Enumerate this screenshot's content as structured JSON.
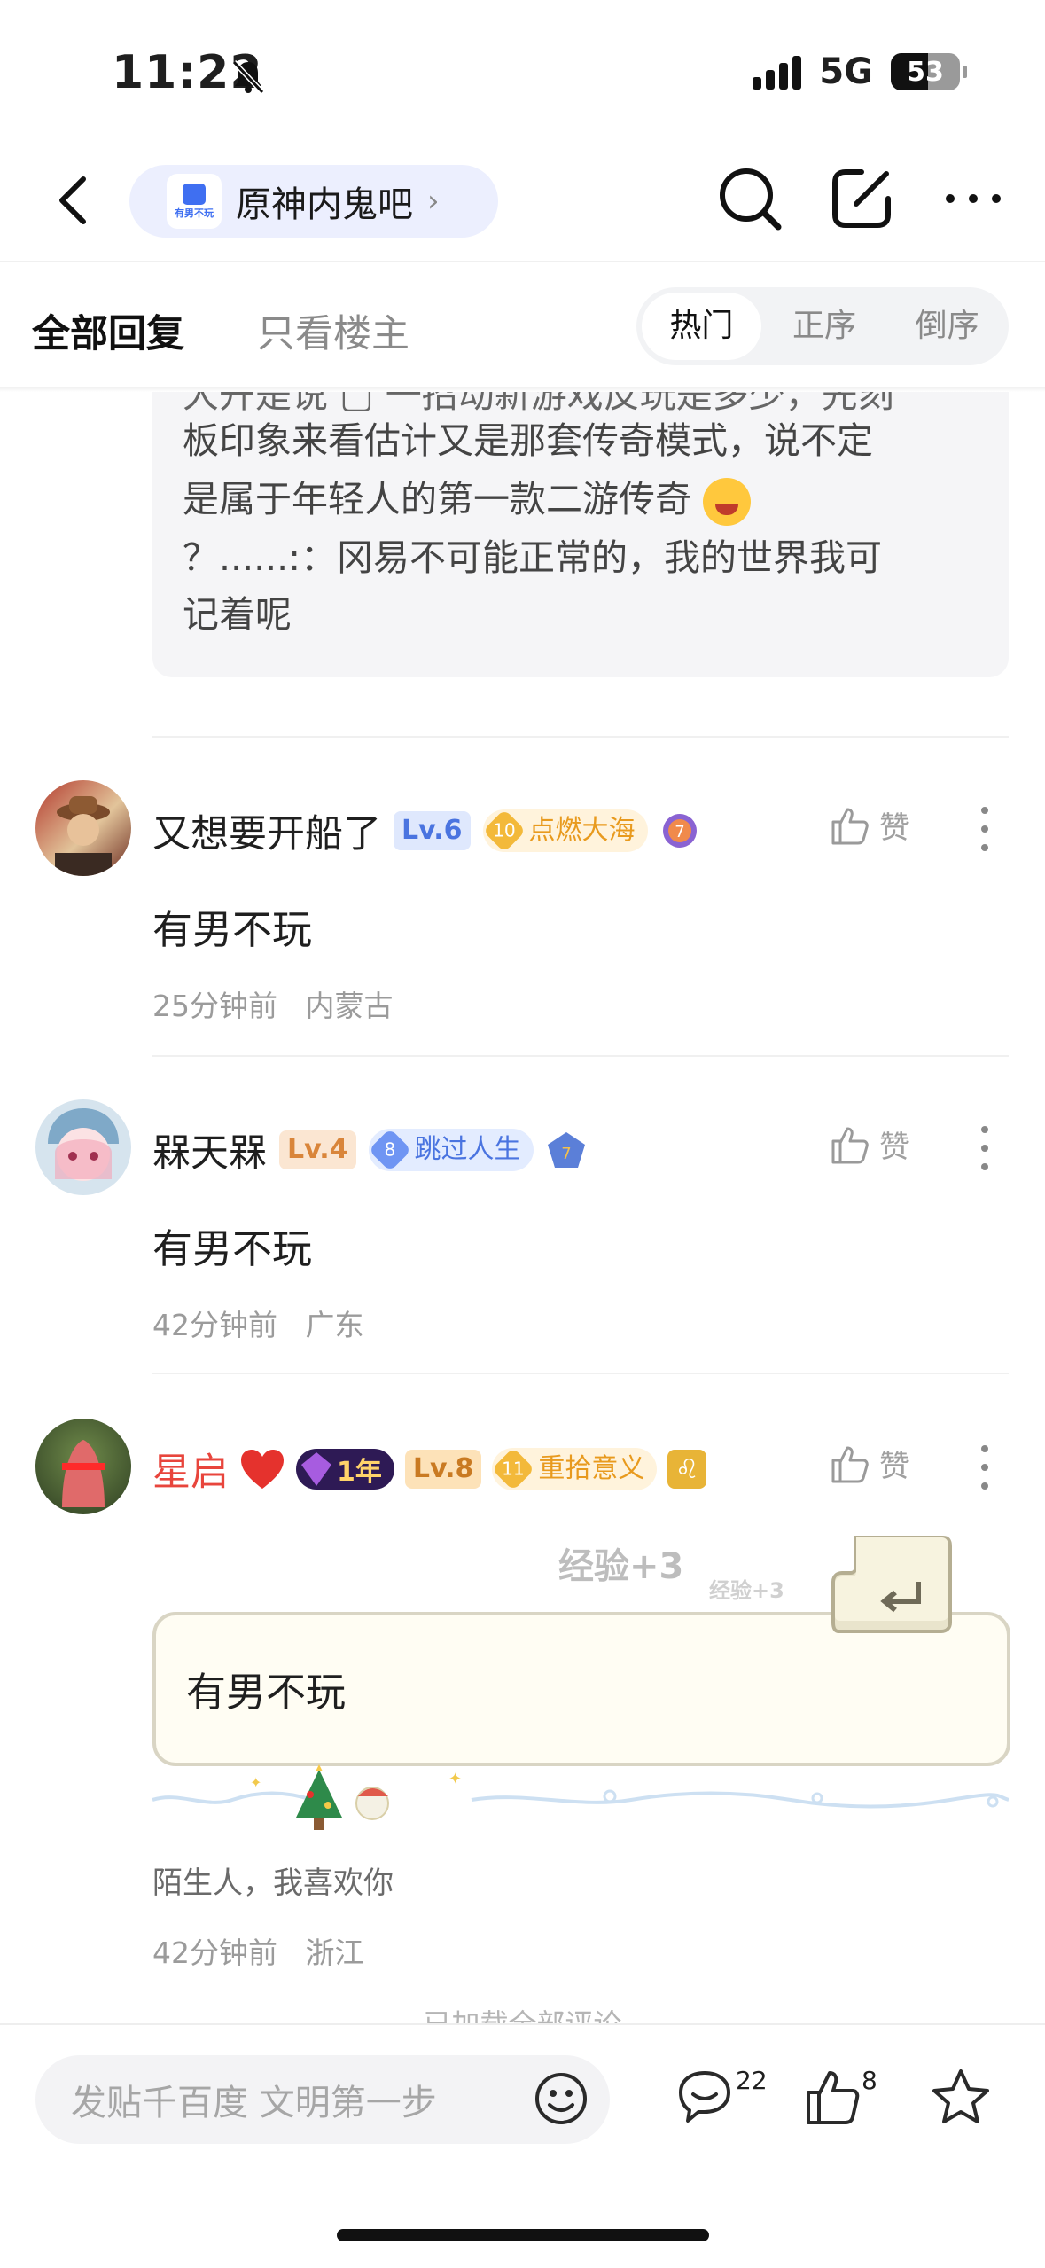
{
  "status_bar": {
    "time": "11:22",
    "network": "5G",
    "battery": "53"
  },
  "nav": {
    "forum_name": "原神内鬼吧",
    "forum_logo_text": "有男不玩"
  },
  "tabs": {
    "all": "全部回复",
    "op_only": "只看楼主",
    "sort": [
      "热门",
      "正序",
      "倒序"
    ],
    "active_sort": "热门"
  },
  "quote": {
    "lines": [
      "板印象来看估计又是那套传奇模式，说不定",
      "是属于年轻人的第一款二游传奇",
      "？......:：冈易不可能正常的，我的世界我可",
      "记着呢"
    ]
  },
  "comments": [
    {
      "user": "又想要开船了",
      "level": "Lv.6",
      "badge_num": "10",
      "badge_text": "点燃大海",
      "extra_badge": "7",
      "like_label": "赞",
      "text": "有男不玩",
      "time": "25分钟前",
      "location": "内蒙古"
    },
    {
      "user": "槑天槑",
      "level": "Lv.4",
      "badge_num": "8",
      "badge_text": "跳过人生",
      "extra_badge": "7",
      "like_label": "赞",
      "text": "有男不玩",
      "time": "42分钟前",
      "location": "广东"
    },
    {
      "user": "星启",
      "level": "Lv.8",
      "year_badge": "1年",
      "badge_num": "11",
      "badge_text": "重拾意义",
      "like_label": "赞",
      "text": "有男不玩",
      "exp_big": "经验+3",
      "exp_small": "经验+3",
      "signature": "陌生人，我喜欢你",
      "time": "42分钟前",
      "location": "浙江"
    }
  ],
  "loaded_all": "已加载全部评论",
  "bottom": {
    "input_placeholder": "发贴千百度 文明第一步",
    "comment_count": "22",
    "like_count": "8"
  },
  "colors": {
    "accent_blue": "#3f6ff1",
    "red_name": "#e8453c",
    "pill_bg": "#eceffe"
  }
}
